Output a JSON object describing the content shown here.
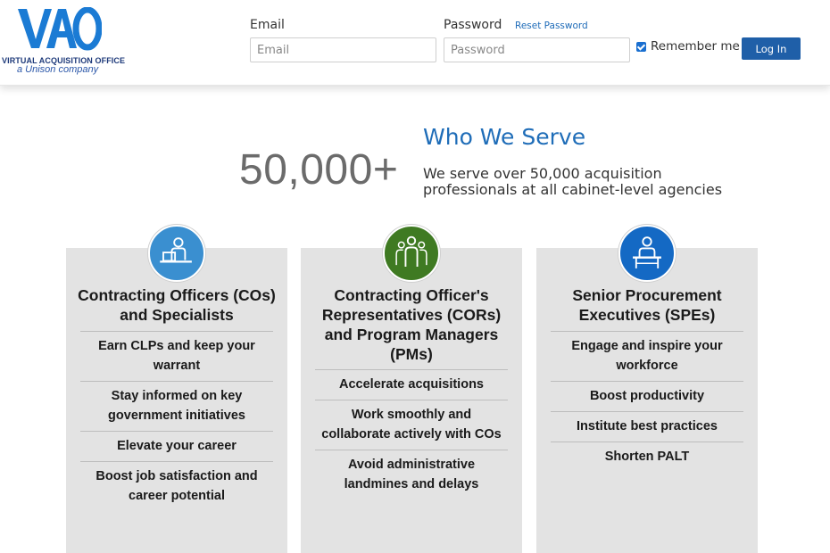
{
  "logo": {
    "mark": "VAO",
    "line1": "VIRTUAL ACQUISITION OFFICE",
    "line2": "a Unison company"
  },
  "login": {
    "email_label": "Email",
    "email_placeholder": "Email",
    "password_label": "Password",
    "password_placeholder": "Password",
    "reset_link": "Reset Password",
    "remember_label": "Remember me",
    "remember_checked": true,
    "login_button": "Log In"
  },
  "serve": {
    "big_number": "50,000+",
    "title": "Who We Serve",
    "description": "We serve over 50,000 acquisition professionals at all cabinet-level agencies"
  },
  "colors": {
    "brand_blue": "#1f6db8",
    "button_blue": "#1f5fa8",
    "card_gray": "#e3e3e3",
    "icon_blue_light": "#3a8fd0",
    "icon_green": "#3f7a22",
    "icon_blue": "#1469c4"
  },
  "cards": [
    {
      "icon": "person-at-laptop-icon",
      "title": "Contracting Officers (COs) and Specialists",
      "items": [
        "Earn CLPs and keep your warrant",
        "Stay informed on key government initiatives",
        "Elevate your career",
        "Boost job satisfaction and career potential"
      ]
    },
    {
      "icon": "team-group-icon",
      "title": "Contracting Officer's Representatives (CORs) and Program Managers (PMs)",
      "items": [
        "Accelerate acquisitions",
        "Work smoothly and collaborate actively with COs",
        "Avoid administrative landmines and delays"
      ]
    },
    {
      "icon": "person-at-desk-icon",
      "title": "Senior Procurement Executives (SPEs)",
      "items": [
        "Engage and inspire your workforce",
        "Boost productivity",
        "Institute best practices",
        "Shorten PALT"
      ]
    }
  ]
}
